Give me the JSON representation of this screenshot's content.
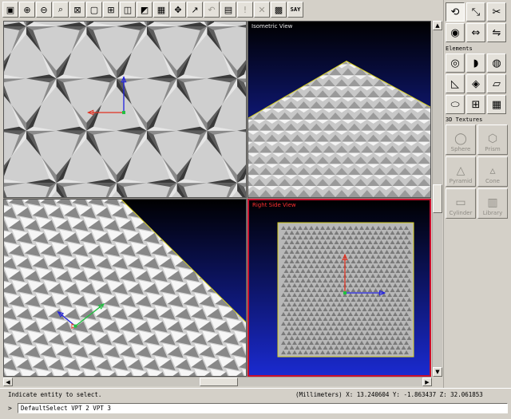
{
  "toolbar": {
    "buttons": [
      {
        "name": "view-all-button",
        "icon": "▣"
      },
      {
        "name": "zoom-in-button",
        "icon": "⊕"
      },
      {
        "name": "zoom-out-button",
        "icon": "⊖"
      },
      {
        "name": "zoom-window-button",
        "icon": "⌕"
      },
      {
        "name": "fit-button",
        "icon": "⊠"
      },
      {
        "name": "single-view-button",
        "icon": "▢"
      },
      {
        "name": "four-views-button",
        "icon": "⊞"
      },
      {
        "name": "cube-view-button",
        "icon": "◫"
      },
      {
        "name": "shaded-view-button",
        "icon": "◩"
      },
      {
        "name": "render-button",
        "icon": "▦"
      },
      {
        "name": "snap-button",
        "icon": "✥"
      },
      {
        "name": "select-arrow-button",
        "icon": "↗"
      },
      {
        "name": "undo-button",
        "icon": "↶",
        "disabled": true
      },
      {
        "name": "layers-button",
        "icon": "▤"
      },
      {
        "name": "info-button",
        "icon": "!",
        "disabled": true
      },
      {
        "name": "delete-button",
        "icon": "✕",
        "disabled": true
      },
      {
        "name": "screenshot-button",
        "icon": "▩"
      }
    ],
    "say_label": "SAY"
  },
  "viewports": {
    "top": {
      "title": ""
    },
    "iso": {
      "title": "Isometric View"
    },
    "front": {
      "title": ""
    },
    "right": {
      "title": "Right Side View"
    }
  },
  "palette": {
    "row1": [
      {
        "name": "rotate-tool",
        "icon": "⟲",
        "pressed": true
      },
      {
        "name": "scale-tool",
        "icon": "⤡"
      },
      {
        "name": "cut-tool",
        "icon": "✂"
      }
    ],
    "row2": [
      {
        "name": "eye-tool",
        "icon": "◉"
      },
      {
        "name": "push-pull-tool",
        "icon": "⇔"
      },
      {
        "name": "mirror-tool",
        "icon": "⇋"
      }
    ],
    "elements_label": "Elements",
    "row3": [
      {
        "name": "revolve-element",
        "icon": "◎"
      },
      {
        "name": "sweep-element",
        "icon": "◗"
      },
      {
        "name": "loft-element",
        "icon": "◍"
      }
    ],
    "row4": [
      {
        "name": "wedge-element",
        "icon": "◺"
      },
      {
        "name": "extrude-element",
        "icon": "◈"
      },
      {
        "name": "plane-element",
        "icon": "▱"
      }
    ],
    "row5": [
      {
        "name": "capsule-element",
        "icon": "⬭"
      },
      {
        "name": "grid-element",
        "icon": "⊞"
      },
      {
        "name": "array-element",
        "icon": "▦"
      }
    ],
    "textures_label": "3D Textures",
    "textures": [
      {
        "name": "sphere",
        "label": "Sphere",
        "icon": "◯"
      },
      {
        "name": "prism",
        "label": "Prism",
        "icon": "⬡"
      },
      {
        "name": "pyramid",
        "label": "Pyramid",
        "icon": "△"
      },
      {
        "name": "cone",
        "label": "Cone",
        "icon": "▵"
      },
      {
        "name": "cylinder",
        "label": "Cylinder",
        "icon": "▭"
      },
      {
        "name": "library",
        "label": "Library",
        "icon": "▥"
      }
    ]
  },
  "status": {
    "message": "Indicate entity to select.",
    "coords": "(Millimeters) X:  13.240604  Y:  -1.863437  Z:  32.061853"
  },
  "command": {
    "prompt": ">",
    "value": "DefaultSelect VPT 2 VPT 3"
  },
  "colors": {
    "viewport_bg_top": "#000000",
    "viewport_bg_bottom": "#1a2ad0",
    "active_border": "#c8102e",
    "axis_red": "#e03020",
    "axis_blue": "#2020e0",
    "axis_green": "#20c040"
  }
}
